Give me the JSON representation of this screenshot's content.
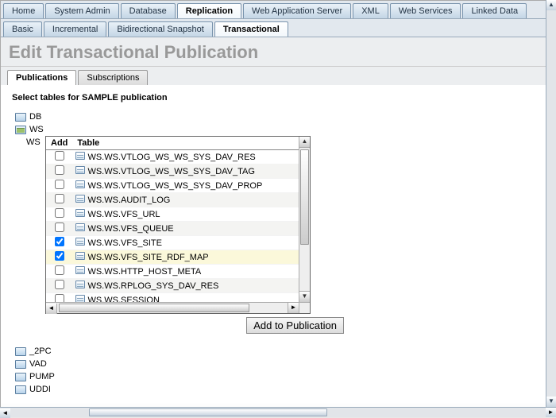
{
  "main_tabs": [
    "Home",
    "System Admin",
    "Database",
    "Replication",
    "Web Application Server",
    "XML",
    "Web Services",
    "Linked Data"
  ],
  "main_tab_active": 3,
  "sub_tabs": [
    "Basic",
    "Incremental",
    "Bidirectional Snapshot",
    "Transactional"
  ],
  "sub_tab_active": 3,
  "page_title": "Edit Transactional Publication",
  "inner_tabs": [
    "Publications",
    "Subscriptions"
  ],
  "inner_tab_active": 0,
  "instruction": "Select tables for SAMPLE publication",
  "tree_top": [
    {
      "label": "DB",
      "open": false
    },
    {
      "label": "WS",
      "open": true
    }
  ],
  "ws_label": "WS",
  "table_headers": {
    "add": "Add",
    "table": "Table"
  },
  "table_rows": [
    {
      "checked": false,
      "name": "WS.WS.VTLOG_WS_WS_SYS_DAV_RES"
    },
    {
      "checked": false,
      "name": "WS.WS.VTLOG_WS_WS_SYS_DAV_TAG"
    },
    {
      "checked": false,
      "name": "WS.WS.VTLOG_WS_WS_SYS_DAV_PROP"
    },
    {
      "checked": false,
      "name": "WS.WS.AUDIT_LOG"
    },
    {
      "checked": false,
      "name": "WS.WS.VFS_URL"
    },
    {
      "checked": false,
      "name": "WS.WS.VFS_QUEUE"
    },
    {
      "checked": true,
      "name": "WS.WS.VFS_SITE"
    },
    {
      "checked": true,
      "name": "WS.WS.VFS_SITE_RDF_MAP",
      "selected": true
    },
    {
      "checked": false,
      "name": "WS.WS.HTTP_HOST_META"
    },
    {
      "checked": false,
      "name": "WS.WS.RPLOG_SYS_DAV_RES"
    },
    {
      "checked": false,
      "name": "WS.WS.SESSION"
    }
  ],
  "add_button": "Add to Publication",
  "bottom_folders": [
    "_2PC",
    "VAD",
    "PUMP",
    "UDDI"
  ]
}
